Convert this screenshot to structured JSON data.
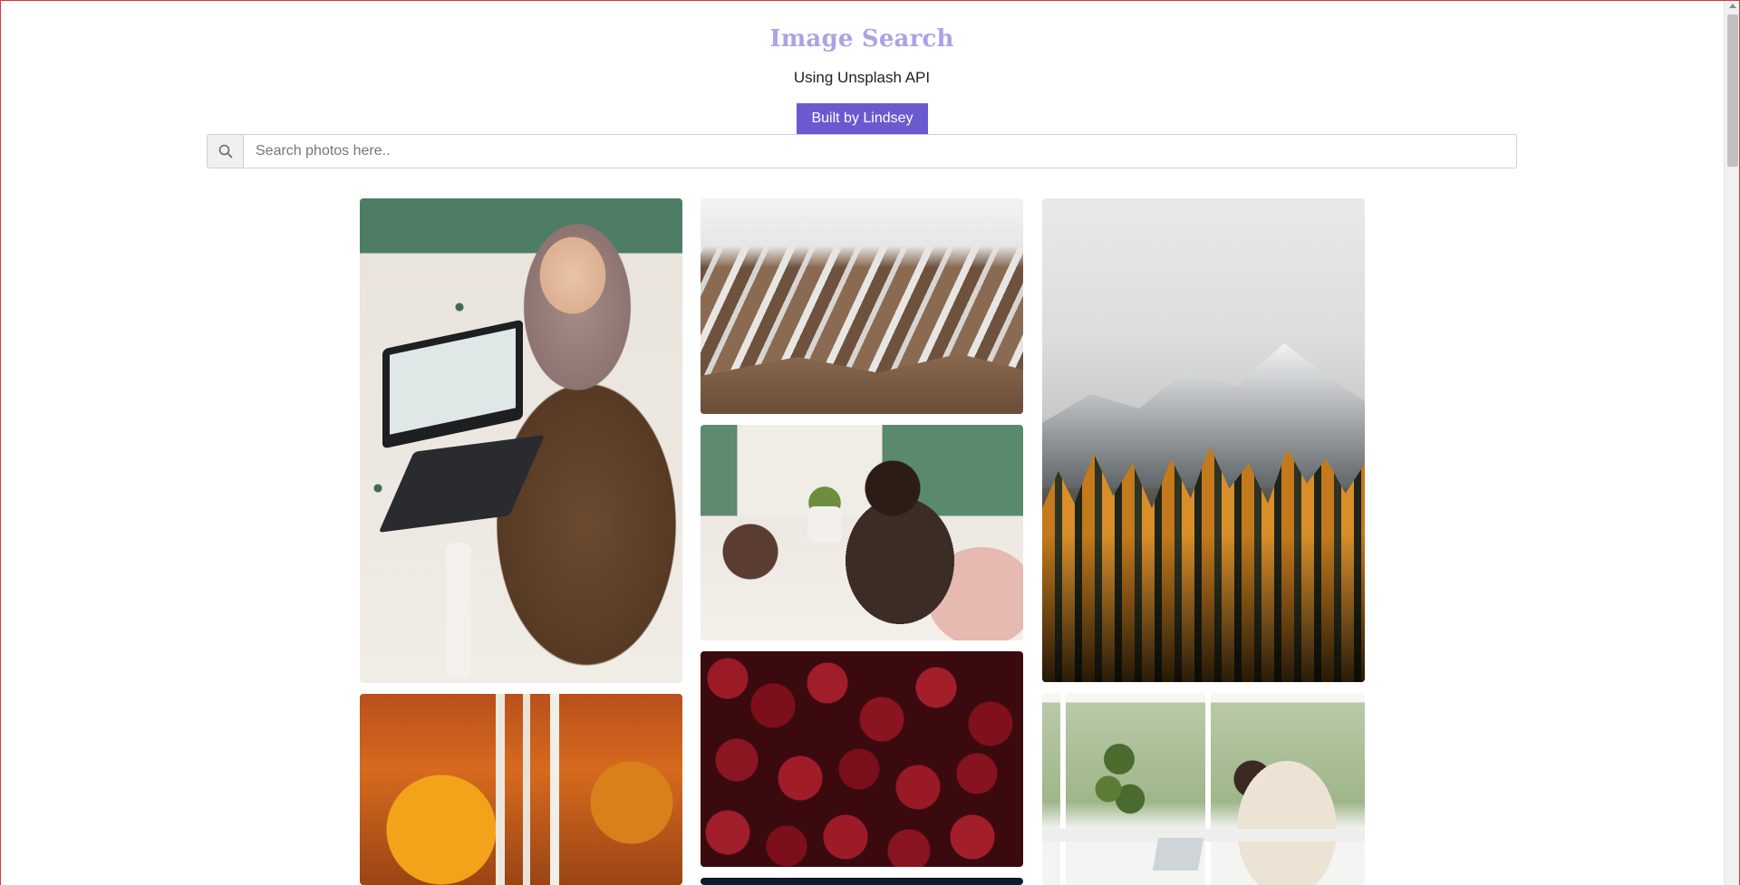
{
  "header": {
    "title": "Image Search",
    "subtitle": "Using Unsplash API",
    "built_by_label": "Built by Lindsey"
  },
  "search": {
    "icon": "search-icon",
    "placeholder": "Search photos here..",
    "value": ""
  },
  "colors": {
    "title": "#a9a4e6",
    "button": "#6a5ad0"
  },
  "photos": [
    {
      "name": "photo-woman-laptop-terrazzo"
    },
    {
      "name": "photo-snowy-mountains"
    },
    {
      "name": "photo-mountain-autumn-forest"
    },
    {
      "name": "photo-two-women-working"
    },
    {
      "name": "photo-autumn-aspens"
    },
    {
      "name": "photo-cherries"
    },
    {
      "name": "photo-woman-desk-window"
    },
    {
      "name": "photo-dark-partial"
    }
  ]
}
